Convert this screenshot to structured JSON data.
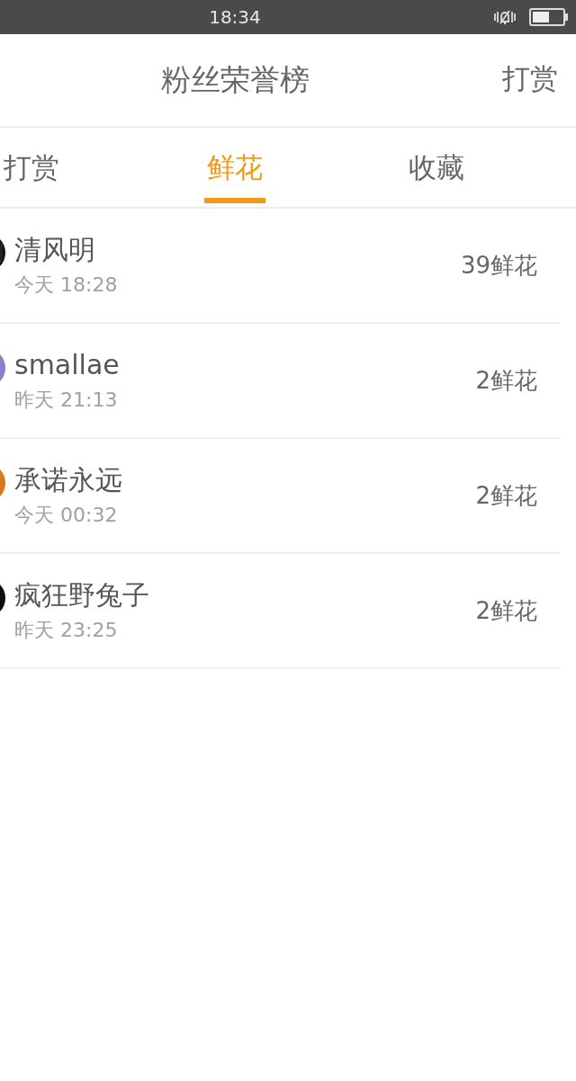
{
  "status_bar": {
    "time": "18:34"
  },
  "header": {
    "title": "粉丝荣誉榜",
    "action": "打赏"
  },
  "tabs": [
    {
      "label": "打赏",
      "selected": false
    },
    {
      "label": "鲜花",
      "selected": true
    },
    {
      "label": "收藏",
      "selected": false
    }
  ],
  "rows": [
    {
      "name": "清风明",
      "time": "今天 18:28",
      "amount": "39鲜花"
    },
    {
      "name": "smallae",
      "time": "昨天 21:13",
      "amount": "2鲜花"
    },
    {
      "name": "承诺永远",
      "time": "今天 00:32",
      "amount": "2鲜花"
    },
    {
      "name": "疯狂野兔子",
      "time": "昨天 23:25",
      "amount": "2鲜花"
    }
  ]
}
